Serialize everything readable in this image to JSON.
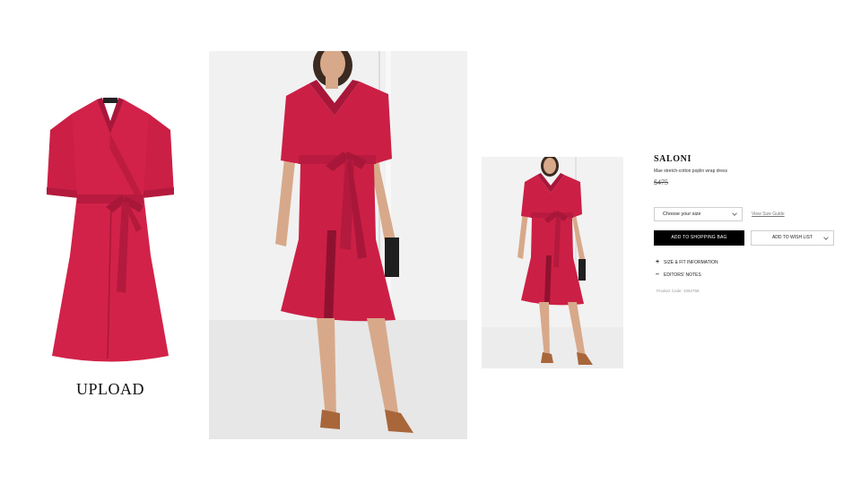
{
  "upload": {
    "label": "UPLOAD"
  },
  "product": {
    "brand": "SALONI",
    "description": "Mae stretch-cotton poplin wrap dress",
    "price": "$475",
    "size_select": {
      "value": "Choose your size"
    },
    "size_guide_link": "View Size Guide",
    "add_to_bag_label": "ADD TO SHOPPING BAG",
    "add_to_wishlist_label": "ADD TO WISH LIST",
    "accordion": [
      {
        "sign": "+",
        "label": "SIZE & FIT INFORMATION"
      },
      {
        "sign": "–",
        "label": "EDITORS' NOTES"
      }
    ],
    "product_code": "Product Code: 1062768"
  },
  "colors": {
    "dress": "#cc1f45",
    "dress_shadow": "#a8173a",
    "skin": "#d7a98a",
    "studio_bg": "#ececec",
    "button_black": "#000000"
  }
}
